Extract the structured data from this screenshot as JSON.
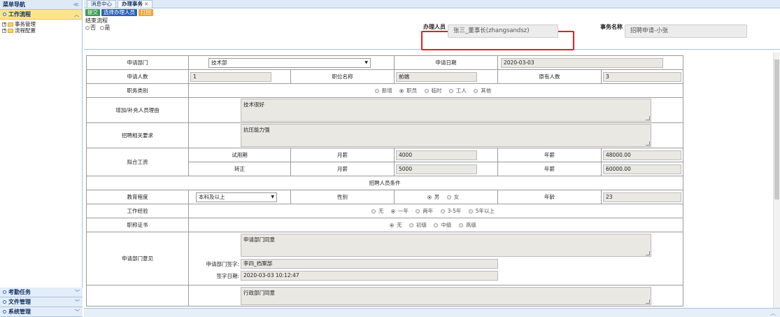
{
  "sidebar": {
    "title": "菜单导航",
    "collapse": "≪",
    "active_panel": "工作流程",
    "tree": [
      "事务管理",
      "流程配置"
    ],
    "bottom_panels": [
      "考勤任务",
      "文件管理",
      "系统管理"
    ]
  },
  "tabs": [
    {
      "label": "消息中心"
    },
    {
      "label": "办理事务",
      "close": "×"
    }
  ],
  "toolbar": {
    "submit": "提交",
    "select_handler": "选择办理人员",
    "print": "打回"
  },
  "top": {
    "end_flow_label": "结束流程",
    "end_flow_no": "否",
    "end_flow_yes": "是",
    "handler_label": "办理人员",
    "handler_value": "张三_董事长(zhangsandsz)",
    "task_label": "事务名称",
    "task_value": "招聘申请-小张"
  },
  "form": {
    "dept_label": "申请部门",
    "dept_value": "技术部",
    "date_label": "申请日期",
    "date_value": "2020-03-03",
    "count_label": "申请人数",
    "count_value": "1",
    "position_label": "职位名称",
    "position_value": "前端",
    "existing_label": "原有人数",
    "existing_value": "3",
    "category_label": "职务类别",
    "category_options": [
      "新增",
      "职员",
      "临时",
      "工人",
      "其他"
    ],
    "reason_label": "增加/补充人员理由",
    "reason_value": "技术很好",
    "require_label": "招聘相关要求",
    "require_value": "抗压能力强",
    "salary_label": "拟合工资",
    "probation_label": "试用期",
    "month_label": "月薪",
    "year_label": "年薪",
    "probation_month": "4000",
    "probation_year": "48000.00",
    "regular_label": "转正",
    "regular_month": "5000",
    "regular_year": "60000.00",
    "conditions_title": "招聘人员条件",
    "edu_label": "教育程度",
    "edu_value": "本科及以上",
    "gender_label": "性别",
    "gender_options": [
      "男",
      "女"
    ],
    "age_label": "年龄",
    "age_value": "23",
    "exp_label": "工作经验",
    "exp_options": [
      "无",
      "一年",
      "两年",
      "3-5年",
      "5年以上"
    ],
    "cert_label": "职称证书",
    "cert_options": [
      "无",
      "初级",
      "中级",
      "高级"
    ],
    "dept_opinion_label": "申请部门意见",
    "dept_opinion_value": "申请部门同意",
    "dept_sign_label": "申请部门签字:",
    "dept_sign_value": "李四_档案部",
    "sign_date_label": "签字日期:",
    "sign_date_value": "2020-03-03 10:12:47",
    "admin_opinion_value": "行政部门同意"
  }
}
